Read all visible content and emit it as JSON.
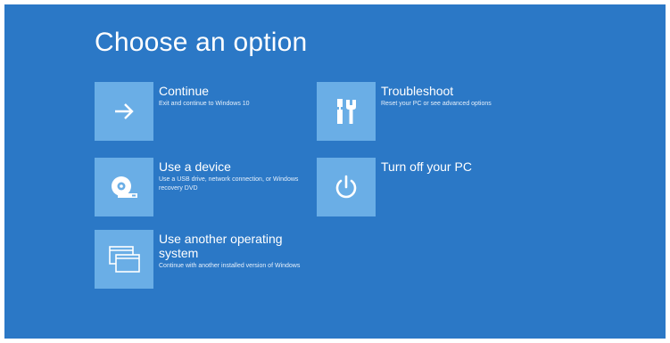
{
  "title": "Choose an option",
  "colors": {
    "background": "#2b78c6",
    "tile": "#6aaee6",
    "text": "#ffffff"
  },
  "options": [
    {
      "label": "Continue",
      "description": "Exit and continue to Windows 10",
      "icon": "arrow-right-icon"
    },
    {
      "label": "Use a device",
      "description": "Use a USB drive, network connection, or Windows recovery DVD",
      "icon": "disc-drive-icon"
    },
    {
      "label": "Use another operating system",
      "description": "Continue with another installed version of Windows",
      "icon": "windows-stack-icon"
    },
    {
      "label": "Troubleshoot",
      "description": "Reset your PC or see advanced options",
      "icon": "tools-icon"
    },
    {
      "label": "Turn off your PC",
      "description": "",
      "icon": "power-icon"
    }
  ]
}
